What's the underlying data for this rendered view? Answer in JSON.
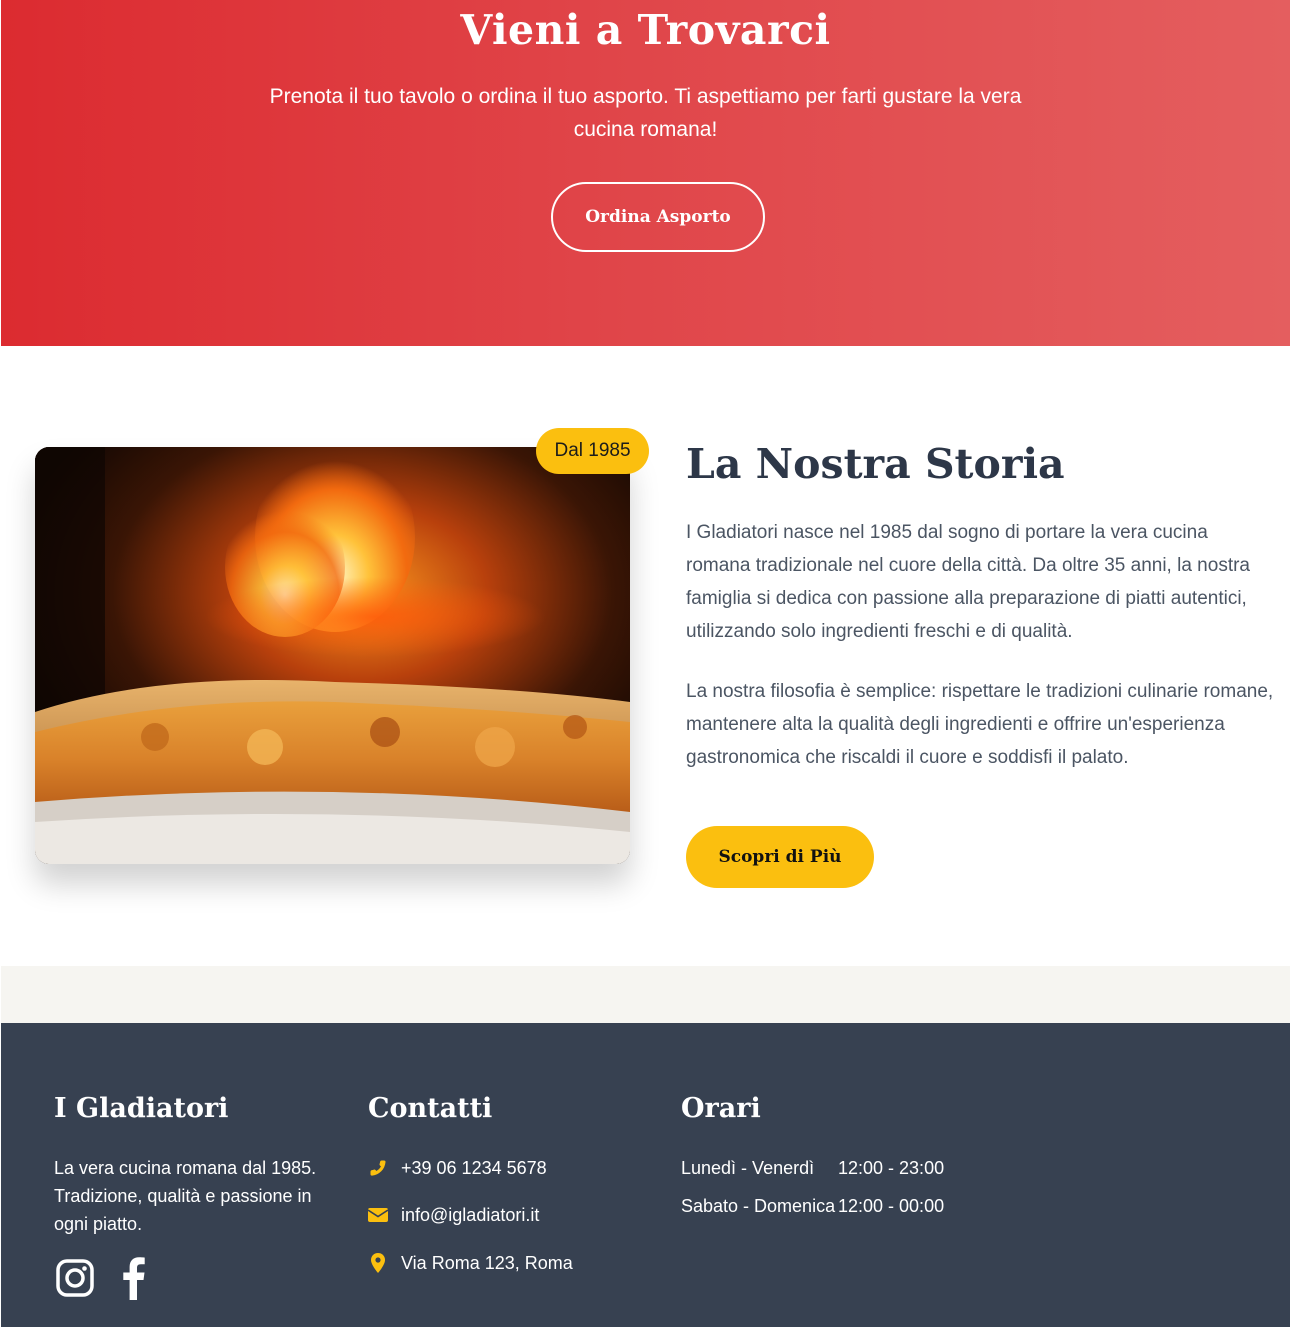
{
  "hero": {
    "title": "Vieni a Trovarci",
    "subtitle": "Prenota il tuo tavolo o ordina il tuo asporto. Ti aspettiamo per farti gustare la vera cucina romana!",
    "button": "Ordina Asporto"
  },
  "story": {
    "badge": "Dal 1985",
    "title": "La Nostra Storia",
    "paragraph1": "I Gladiatori nasce nel 1985 dal sogno di portare la vera cucina romana tradizionale nel cuore della città. Da oltre 35 anni, la nostra famiglia si dedica con passione alla preparazione di piatti autentici, utilizzando solo ingredienti freschi e di qualità.",
    "paragraph2": "La nostra filosofia è semplice: rispettare le tradizioni culinarie romane, mantenere alta la qualità degli ingredienti e offrire un'esperienza gastronomica che riscaldi il cuore e soddisfi il palato.",
    "button": "Scopri di Più",
    "image_icon": "pizza-oven-photo"
  },
  "footer": {
    "brand": {
      "title": "I Gladiatori",
      "description": "La vera cucina romana dal 1985. Tradizione, qualità e passione in ogni piatto.",
      "social": [
        "instagram-icon",
        "facebook-icon"
      ]
    },
    "contacts": {
      "title": "Contatti",
      "phone": "+39 06 1234 5678",
      "email": "info@igladiatori.it",
      "address": "Via Roma 123, Roma"
    },
    "hours": {
      "title": "Orari",
      "rows": [
        {
          "day": "Lunedì - Venerdì",
          "time": "12:00 - 23:00"
        },
        {
          "day": "Sabato - Domenica",
          "time": "12:00 - 00:00"
        }
      ]
    }
  },
  "colors": {
    "hero_red": "#dc2b30",
    "accent_yellow": "#fbbf0f",
    "footer_bg": "#374151",
    "heading_dark": "#2d3748"
  }
}
